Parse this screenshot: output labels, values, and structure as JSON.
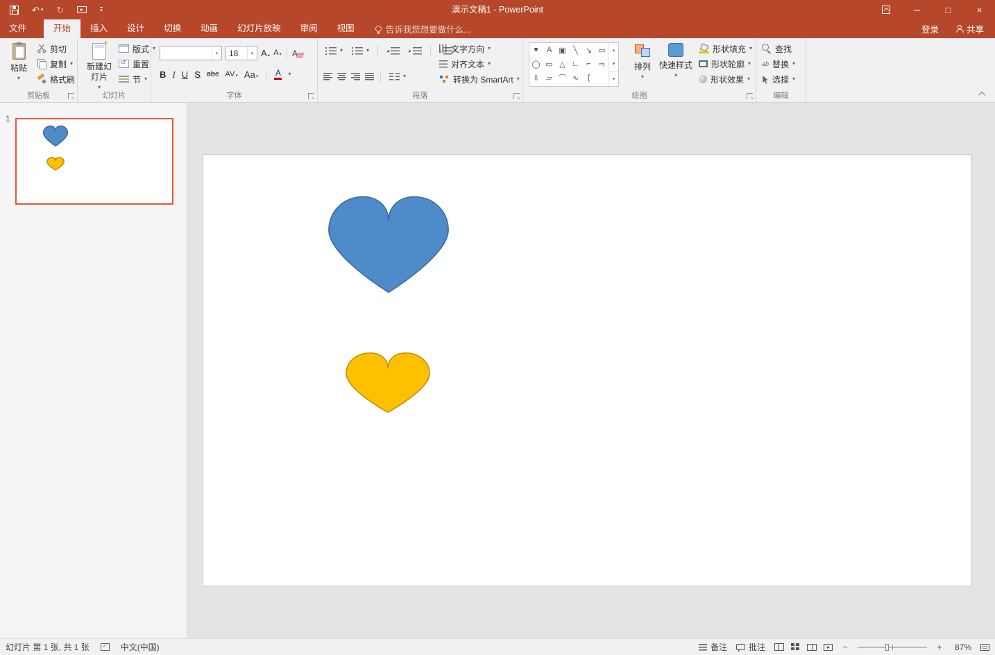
{
  "titlebar": {
    "title": "演示文稿1 - PowerPoint"
  },
  "icons": {
    "dropdown": "▾",
    "undo": "↶",
    "redo": "↻",
    "minimize": "─",
    "maximize": "□",
    "close": "×",
    "scroll_up": "▴",
    "scroll_down": "▾",
    "zoom_out": "−",
    "zoom_in": "+",
    "up_tri": "▴",
    "down_tri": "▾",
    "left_tri": "◂",
    "right_tri": "▸",
    "updown": "↕"
  },
  "tabs": {
    "file": "文件",
    "items": [
      "开始",
      "插入",
      "设计",
      "切换",
      "动画",
      "幻灯片放映",
      "审阅",
      "视图"
    ],
    "tellme": "告诉我您想要做什么...",
    "signin": "登录",
    "share": "共享"
  },
  "ribbon": {
    "clipboard": {
      "label": "剪贴板",
      "paste": "粘贴",
      "cut": "剪切",
      "copy": "复制",
      "format_painter": "格式刷"
    },
    "slides": {
      "label": "幻灯片",
      "new_slide": "新建幻灯片",
      "layout": "版式",
      "reset": "重置",
      "section": "节"
    },
    "font": {
      "label": "字体",
      "name": "",
      "size": "18",
      "increase": "A",
      "decrease": "A",
      "clear": "A",
      "bold": "B",
      "italic": "I",
      "underline": "U",
      "shadow": "S",
      "strikethrough": "abc",
      "spacing": "AV",
      "case": "Aa",
      "color": "A"
    },
    "paragraph": {
      "label": "段落",
      "text_direction": "文字方向",
      "align_text": "对齐文本",
      "smartart": "转换为 SmartArt"
    },
    "drawing": {
      "label": "绘图",
      "arrange": "排列",
      "quick_styles": "快速样式",
      "fill": "形状填充",
      "outline": "形状轮廓",
      "effects": "形状效果",
      "shape_rows": [
        [
          "♥",
          "A",
          "▣",
          "╲",
          "↘",
          "▭"
        ],
        [
          "◯",
          "▭",
          "△",
          "∟",
          "⌐",
          "⇨"
        ],
        [
          "⇩",
          "▱",
          "⌒",
          "∿",
          "{"
        ]
      ]
    },
    "editing": {
      "label": "编辑",
      "find": "查找",
      "replace": "替换",
      "select": "选择"
    }
  },
  "slides_panel": {
    "slide_number": "1"
  },
  "statusbar": {
    "slide_info": "幻灯片 第 1 张, 共 1 张",
    "language": "中文(中国)",
    "notes": "备注",
    "comments": "批注",
    "zoom": "87%"
  },
  "colors": {
    "accent": "#B7472A",
    "selection": "#E8563A",
    "heart_blue": "#4E8BC8",
    "heart_blue_border": "#3A6B9D",
    "heart_yellow": "#FFC000",
    "heart_yellow_border": "#BA8D00"
  }
}
